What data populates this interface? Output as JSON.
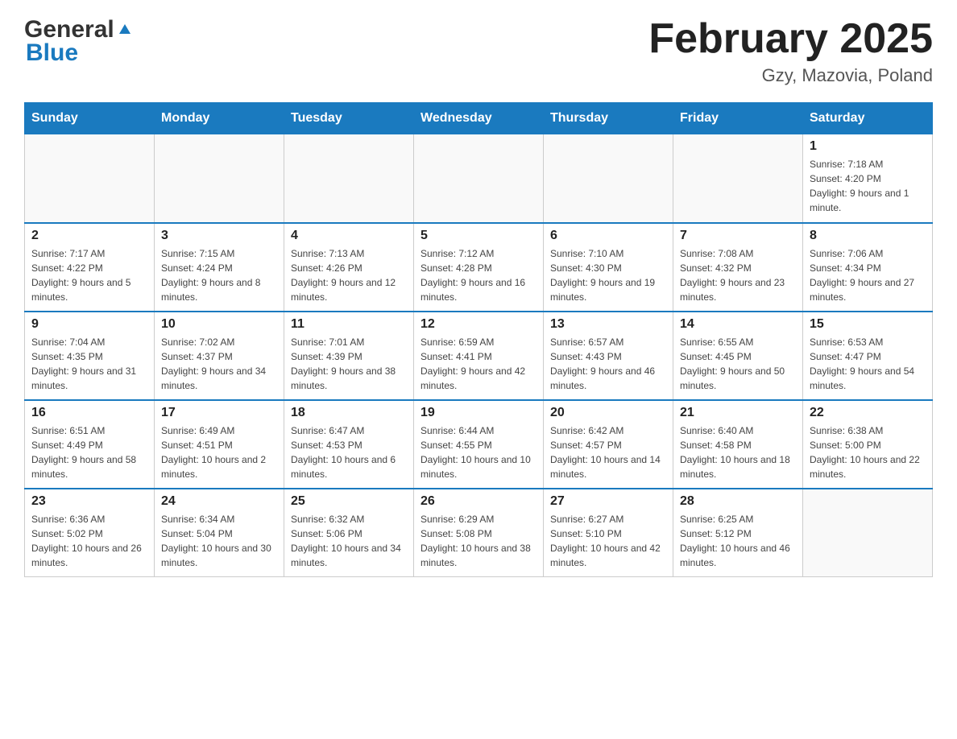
{
  "header": {
    "logo_general": "General",
    "logo_blue": "Blue",
    "month_title": "February 2025",
    "location": "Gzy, Mazovia, Poland"
  },
  "days_of_week": [
    "Sunday",
    "Monday",
    "Tuesday",
    "Wednesday",
    "Thursday",
    "Friday",
    "Saturday"
  ],
  "weeks": [
    [
      {
        "day": "",
        "info": ""
      },
      {
        "day": "",
        "info": ""
      },
      {
        "day": "",
        "info": ""
      },
      {
        "day": "",
        "info": ""
      },
      {
        "day": "",
        "info": ""
      },
      {
        "day": "",
        "info": ""
      },
      {
        "day": "1",
        "info": "Sunrise: 7:18 AM\nSunset: 4:20 PM\nDaylight: 9 hours and 1 minute."
      }
    ],
    [
      {
        "day": "2",
        "info": "Sunrise: 7:17 AM\nSunset: 4:22 PM\nDaylight: 9 hours and 5 minutes."
      },
      {
        "day": "3",
        "info": "Sunrise: 7:15 AM\nSunset: 4:24 PM\nDaylight: 9 hours and 8 minutes."
      },
      {
        "day": "4",
        "info": "Sunrise: 7:13 AM\nSunset: 4:26 PM\nDaylight: 9 hours and 12 minutes."
      },
      {
        "day": "5",
        "info": "Sunrise: 7:12 AM\nSunset: 4:28 PM\nDaylight: 9 hours and 16 minutes."
      },
      {
        "day": "6",
        "info": "Sunrise: 7:10 AM\nSunset: 4:30 PM\nDaylight: 9 hours and 19 minutes."
      },
      {
        "day": "7",
        "info": "Sunrise: 7:08 AM\nSunset: 4:32 PM\nDaylight: 9 hours and 23 minutes."
      },
      {
        "day": "8",
        "info": "Sunrise: 7:06 AM\nSunset: 4:34 PM\nDaylight: 9 hours and 27 minutes."
      }
    ],
    [
      {
        "day": "9",
        "info": "Sunrise: 7:04 AM\nSunset: 4:35 PM\nDaylight: 9 hours and 31 minutes."
      },
      {
        "day": "10",
        "info": "Sunrise: 7:02 AM\nSunset: 4:37 PM\nDaylight: 9 hours and 34 minutes."
      },
      {
        "day": "11",
        "info": "Sunrise: 7:01 AM\nSunset: 4:39 PM\nDaylight: 9 hours and 38 minutes."
      },
      {
        "day": "12",
        "info": "Sunrise: 6:59 AM\nSunset: 4:41 PM\nDaylight: 9 hours and 42 minutes."
      },
      {
        "day": "13",
        "info": "Sunrise: 6:57 AM\nSunset: 4:43 PM\nDaylight: 9 hours and 46 minutes."
      },
      {
        "day": "14",
        "info": "Sunrise: 6:55 AM\nSunset: 4:45 PM\nDaylight: 9 hours and 50 minutes."
      },
      {
        "day": "15",
        "info": "Sunrise: 6:53 AM\nSunset: 4:47 PM\nDaylight: 9 hours and 54 minutes."
      }
    ],
    [
      {
        "day": "16",
        "info": "Sunrise: 6:51 AM\nSunset: 4:49 PM\nDaylight: 9 hours and 58 minutes."
      },
      {
        "day": "17",
        "info": "Sunrise: 6:49 AM\nSunset: 4:51 PM\nDaylight: 10 hours and 2 minutes."
      },
      {
        "day": "18",
        "info": "Sunrise: 6:47 AM\nSunset: 4:53 PM\nDaylight: 10 hours and 6 minutes."
      },
      {
        "day": "19",
        "info": "Sunrise: 6:44 AM\nSunset: 4:55 PM\nDaylight: 10 hours and 10 minutes."
      },
      {
        "day": "20",
        "info": "Sunrise: 6:42 AM\nSunset: 4:57 PM\nDaylight: 10 hours and 14 minutes."
      },
      {
        "day": "21",
        "info": "Sunrise: 6:40 AM\nSunset: 4:58 PM\nDaylight: 10 hours and 18 minutes."
      },
      {
        "day": "22",
        "info": "Sunrise: 6:38 AM\nSunset: 5:00 PM\nDaylight: 10 hours and 22 minutes."
      }
    ],
    [
      {
        "day": "23",
        "info": "Sunrise: 6:36 AM\nSunset: 5:02 PM\nDaylight: 10 hours and 26 minutes."
      },
      {
        "day": "24",
        "info": "Sunrise: 6:34 AM\nSunset: 5:04 PM\nDaylight: 10 hours and 30 minutes."
      },
      {
        "day": "25",
        "info": "Sunrise: 6:32 AM\nSunset: 5:06 PM\nDaylight: 10 hours and 34 minutes."
      },
      {
        "day": "26",
        "info": "Sunrise: 6:29 AM\nSunset: 5:08 PM\nDaylight: 10 hours and 38 minutes."
      },
      {
        "day": "27",
        "info": "Sunrise: 6:27 AM\nSunset: 5:10 PM\nDaylight: 10 hours and 42 minutes."
      },
      {
        "day": "28",
        "info": "Sunrise: 6:25 AM\nSunset: 5:12 PM\nDaylight: 10 hours and 46 minutes."
      },
      {
        "day": "",
        "info": ""
      }
    ]
  ],
  "colors": {
    "header_bg": "#1a7abf",
    "header_text": "#ffffff",
    "border": "#cccccc",
    "blue_accent": "#1a7abf"
  }
}
